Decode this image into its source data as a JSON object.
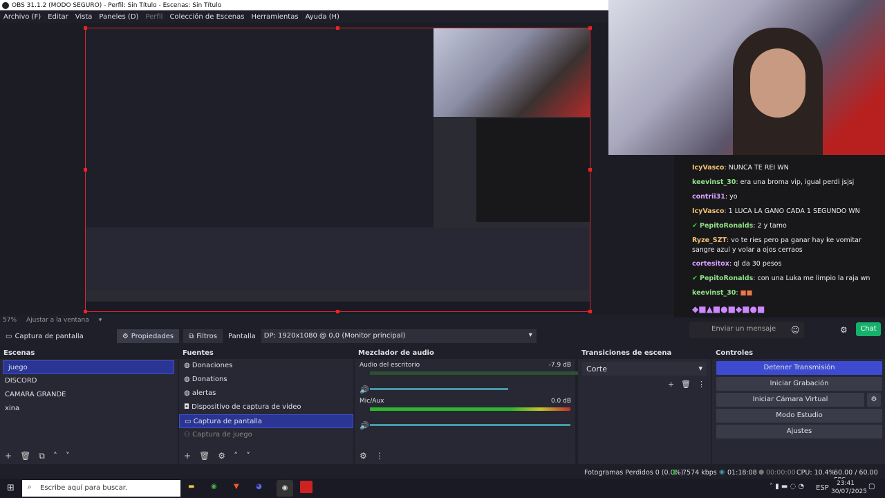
{
  "titlebar": {
    "title": "OBS 31.1.2 (MODO SEGURO) - Perfil: Sin Título - Escenas: Sin Título"
  },
  "menu": {
    "items": [
      "Archivo (F)",
      "Editar",
      "Vista",
      "Paneles (D)",
      "Perfil",
      "Colección de Escenas",
      "Herramientas",
      "Ayuda (H)"
    ]
  },
  "preview": {
    "zoom": "57%",
    "fit": "Ajustar a la ventana"
  },
  "chat": {
    "messages": [
      {
        "user": "IcyVasco",
        "text": "NUNCA TE REI WN"
      },
      {
        "user": "keevinst_30",
        "text": "era una broma vip, igual perdi jsjsj"
      },
      {
        "user": "contrii31",
        "text": "yo"
      },
      {
        "user": "IcyVasco",
        "text": "1 LUCA LA GANO CADA 1 SEGUNDO WN"
      },
      {
        "user": "PepitoRonalds",
        "text": "2 y tamo"
      },
      {
        "user": "Ryze_SZT",
        "text": "vo te ries pero pa ganar hay ke vomitar sangre azul y volar a ojos cerraos"
      },
      {
        "user": "cortesitox",
        "text": "ql da 30 pesos"
      },
      {
        "user": "PepitoRonalds",
        "text": "con una Luka me limpio la raja wn"
      },
      {
        "user": "keevinst_30",
        "text": ""
      }
    ],
    "input_placeholder": "Enviar un mensaje",
    "send_label": "Chat",
    "user_colors": {
      "IcyVasco": "#f0c070",
      "keevinst_30": "#8fe085",
      "contrii31": "#d8a0ff",
      "PepitoRonalds": "#8fe085",
      "Ryze_SZT": "#f0c070",
      "cortesitox": "#d8a0ff"
    }
  },
  "sourcebar": {
    "selected": "Captura de pantalla",
    "props": "Propiedades",
    "filters": "Filtros",
    "display_label": "Pantalla",
    "display_value": "DP: 1920x1080 @ 0,0 (Monitor principal)"
  },
  "scenes": {
    "title": "Escenas",
    "items": [
      "juego",
      "DISCORD",
      "CAMARA GRANDE",
      "xina"
    ]
  },
  "sources": {
    "title": "Fuentes",
    "items": [
      {
        "label": "Donaciones",
        "icon": "globe-icon"
      },
      {
        "label": "Donations",
        "icon": "globe-icon"
      },
      {
        "label": "alertas",
        "icon": "globe-icon"
      },
      {
        "label": "Dispositivo de captura de video",
        "icon": "camera-icon"
      },
      {
        "label": "Captura de pantalla",
        "icon": "monitor-icon"
      },
      {
        "label": "Captura de juego",
        "icon": "gamepad-icon"
      }
    ]
  },
  "mixer": {
    "title": "Mezclador de audio",
    "channels": [
      {
        "name": "Audio del escritorio",
        "db": "-7.9 dB",
        "level": 0.37
      },
      {
        "name": "Mic/Aux",
        "db": "0.0 dB",
        "level": 0.9
      }
    ],
    "ticks": [
      "-60",
      "-55",
      "-50",
      "-45",
      "-40",
      "-35",
      "-30",
      "-25",
      "-20",
      "-15",
      "-10",
      "-5",
      "0"
    ]
  },
  "transitions": {
    "title": "Transiciones de escena",
    "value": "Corte"
  },
  "controls": {
    "title": "Controles",
    "buttons": [
      "Detener Transmisión",
      "Iniciar Grabación",
      "Iniciar Cámara Virtual",
      "Modo Estudio",
      "Ajustes"
    ]
  },
  "status": {
    "dropped": "Fotogramas Perdidos 0 (0.0%)",
    "bitrate": "7574 kbps",
    "stream_time": "01:18:08",
    "rec_time": "00:00:00",
    "cpu": "CPU: 10.4%",
    "fps": "60.00 / 60.00 FPS"
  },
  "taskbar": {
    "search": "Escribe aquí para buscar.",
    "lang": "ESP",
    "time": "23:41",
    "date": "30/07/2025"
  }
}
